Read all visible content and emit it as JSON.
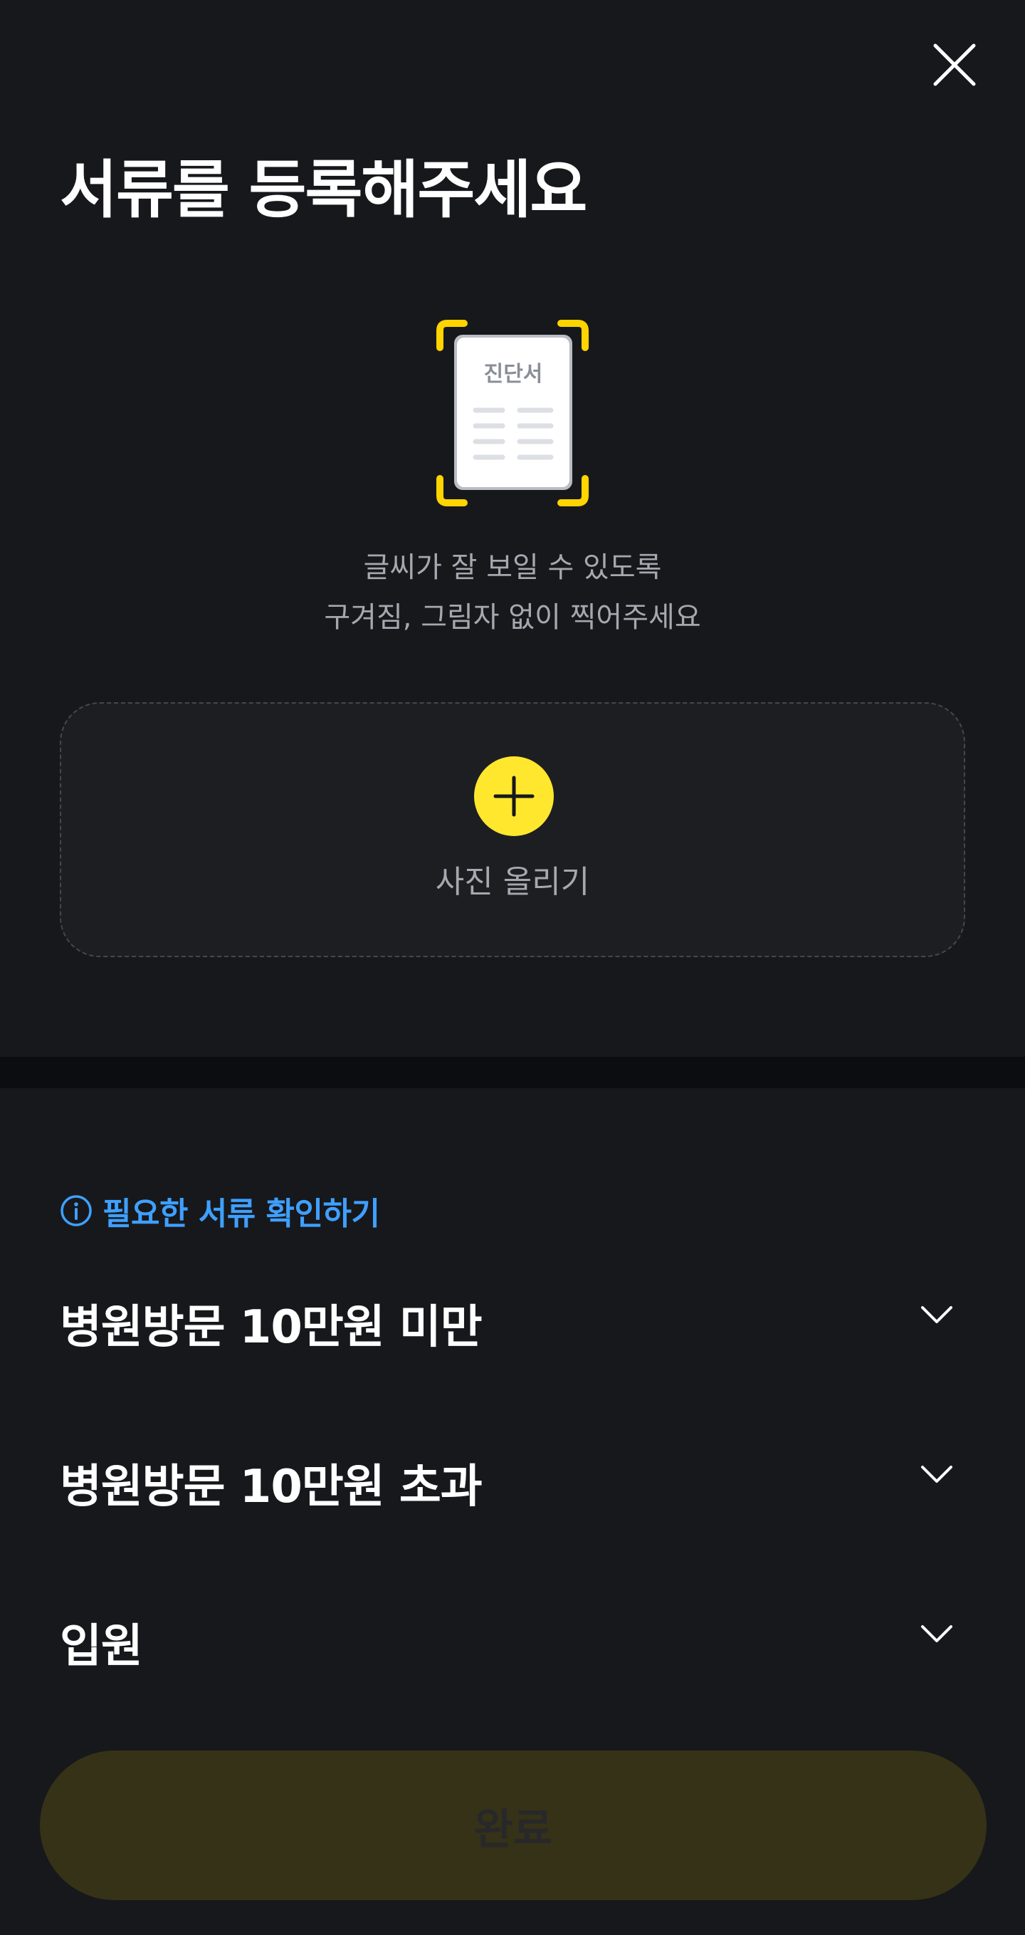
{
  "header": {
    "title": "서류를 등록해주세요",
    "close_icon": "close-icon"
  },
  "illustration": {
    "doc_label": "진단서",
    "frame_color": "#ffd400"
  },
  "hints": {
    "line1": "글씨가 잘 보일 수 있도록",
    "line2": "구겨짐, 그림자 없이 찍어주세요"
  },
  "upload": {
    "label": "사진 올리기",
    "icon": "plus-icon",
    "accent": "#ffe72e"
  },
  "required_docs": {
    "link_label": "필요한 서류 확인하기",
    "icon": "info-icon",
    "color": "#3fa0ff"
  },
  "accordion": [
    {
      "label": "병원방문 10만원 미만",
      "icon": "chevron-down-icon"
    },
    {
      "label": "병원방문 10만원 초과",
      "icon": "chevron-down-icon"
    },
    {
      "label": "입원",
      "icon": "chevron-down-icon"
    }
  ],
  "footer": {
    "done_label": "완료",
    "done_state": "disabled"
  }
}
